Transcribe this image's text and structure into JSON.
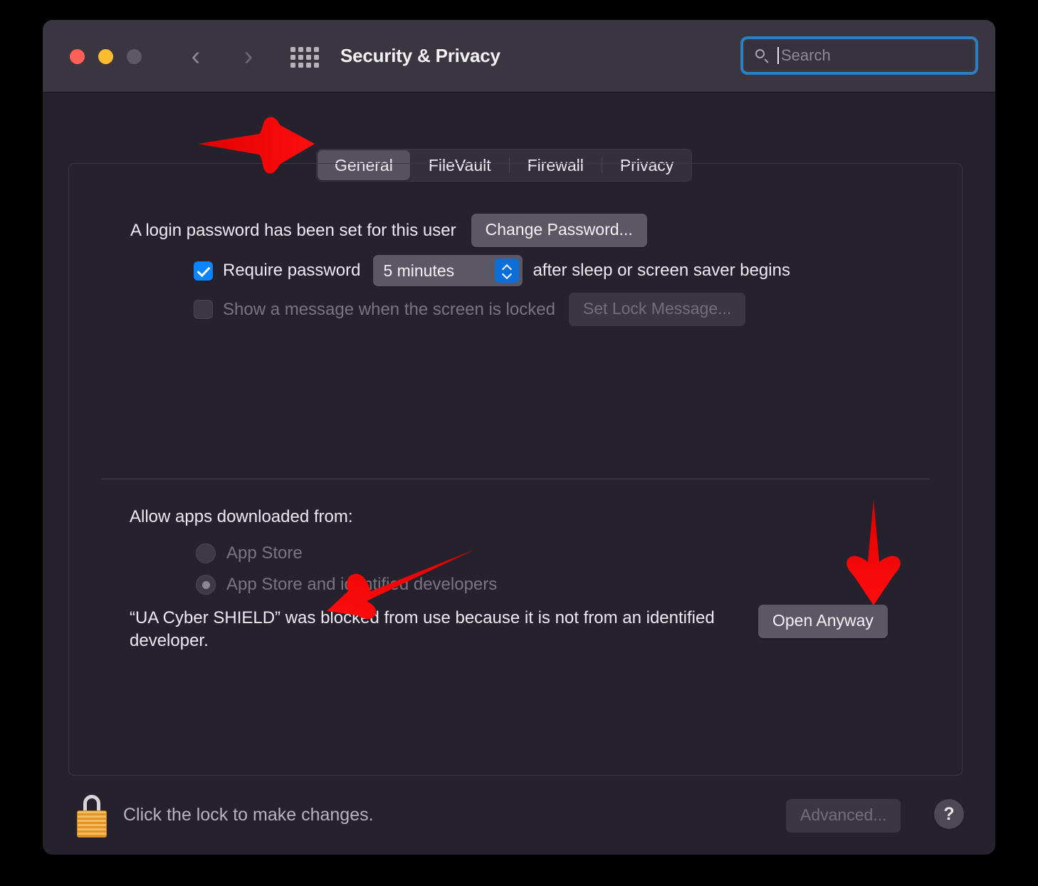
{
  "window": {
    "title": "Security & Privacy",
    "traffic_lights": [
      "close",
      "minimize",
      "zoom"
    ],
    "nav_back_icon": "chevron-left-icon",
    "nav_forward_icon": "chevron-right-icon",
    "grid_icon": "show-all-grid-icon"
  },
  "search": {
    "placeholder": "Search",
    "value": "",
    "icon": "search-icon",
    "focus_ring_color": "#2d7fc4"
  },
  "tabs": [
    {
      "label": "General",
      "selected": true
    },
    {
      "label": "FileVault",
      "selected": false
    },
    {
      "label": "Firewall",
      "selected": false
    },
    {
      "label": "Privacy",
      "selected": false
    }
  ],
  "general": {
    "login_password_text": "A login password has been set for this user",
    "change_password_button": "Change Password...",
    "require_password": {
      "label": "Require password",
      "checked": true,
      "delay_value": "5 minutes",
      "suffix": "after sleep or screen saver begins"
    },
    "lock_message": {
      "label": "Show a message when the screen is locked",
      "checked": false,
      "button": "Set Lock Message...",
      "disabled": true
    },
    "allow_apps": {
      "title": "Allow apps downloaded from:",
      "options": [
        {
          "label": "App Store",
          "selected": false
        },
        {
          "label": "App Store and identified developers",
          "selected": true
        }
      ],
      "disabled": true
    },
    "blocked_message": "“UA Cyber SHIELD” was blocked from use because it is not from an identified developer.",
    "open_anyway_button": "Open Anyway"
  },
  "footer": {
    "lock_icon": "closed-padlock-icon",
    "lock_text": "Click the lock to make changes.",
    "advanced_button": "Advanced...",
    "advanced_disabled": true,
    "help_button": "?"
  },
  "annotations": {
    "accent_color": "#ee0000",
    "arrows": [
      {
        "name": "arrow-pointing-general-tab",
        "direction": "right"
      },
      {
        "name": "arrow-pointing-open-anyway",
        "direction": "down"
      },
      {
        "name": "arrow-pointing-blocked-message",
        "direction": "down-left"
      }
    ]
  }
}
